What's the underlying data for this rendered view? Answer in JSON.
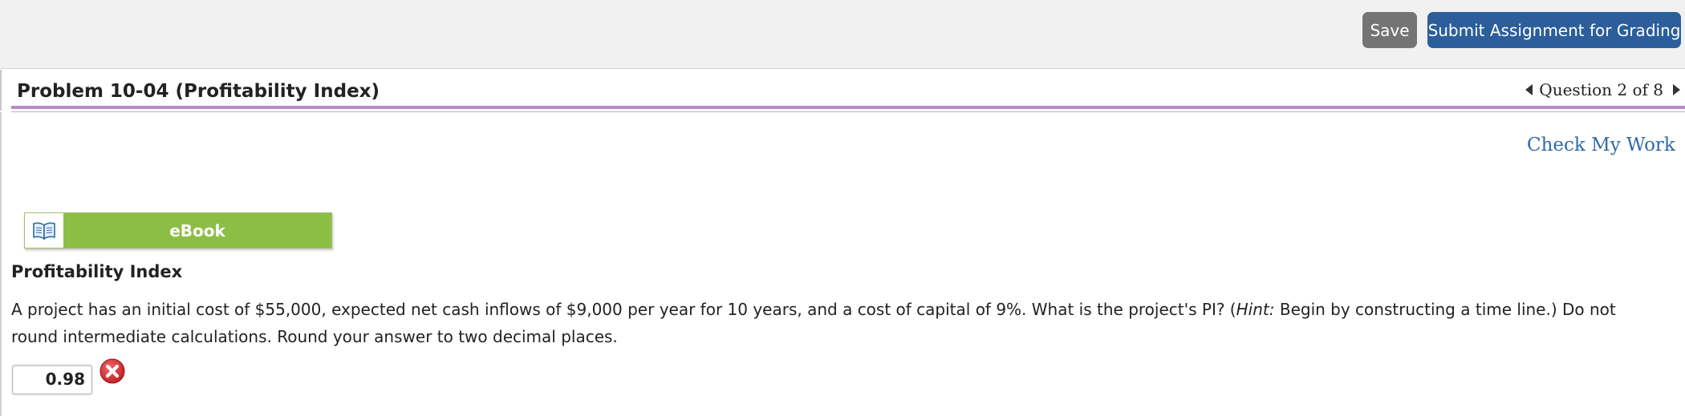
{
  "toolbar": {
    "save_label": "Save",
    "submit_label": "Submit Assignment for Grading"
  },
  "header": {
    "title": "Problem 10-04 (Profitability Index)",
    "question_nav": "Question 2 of 8"
  },
  "check_my_work_label": "Check My Work",
  "ebook_label": "eBook",
  "section_title": "Profitability Index",
  "question": {
    "part1": "A project has an initial cost of $55,000, expected net cash inflows of $9,000 per year for 10 years, and a cost of capital of 9%. What is the project's PI? (",
    "hint": "Hint:",
    "part2": " Begin by constructing a time line.) Do not round intermediate calculations. Round your answer to two decimal places."
  },
  "answer": {
    "value": "0.98",
    "status": "incorrect",
    "status_icon": "x-circle-icon"
  },
  "colors": {
    "submit_bg": "#2b5e9a",
    "save_bg": "#747474",
    "ebook_green": "#8cbe45",
    "accent_rule": "#b88cc2",
    "link": "#2f6aa9",
    "error_red": "#d9262c"
  }
}
